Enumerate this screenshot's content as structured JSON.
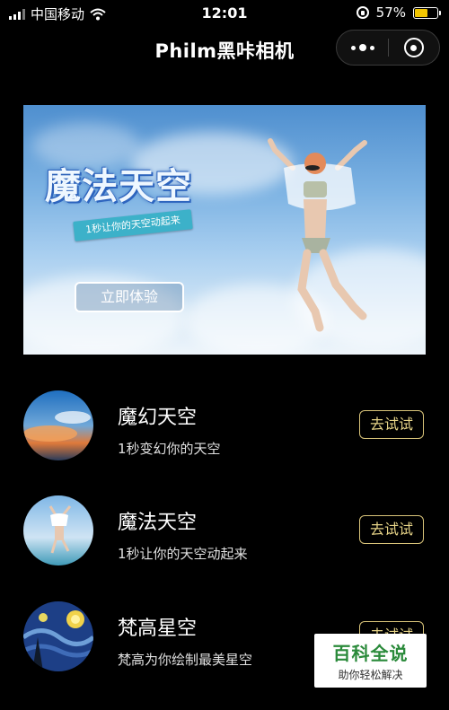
{
  "status_bar": {
    "carrier": "中国移动",
    "time": "12:01",
    "battery_percent": "57%",
    "battery_level": 0.57,
    "icons": [
      "signal-icon",
      "wifi-icon",
      "rotation-lock-icon",
      "battery-icon"
    ]
  },
  "nav": {
    "title": "Philm黑咔相机",
    "more_icon": "more-dots-icon",
    "close_icon": "close-circle-icon"
  },
  "banner": {
    "title": "魔法天空",
    "subtitle": "1秒让你的天空动起来",
    "button_label": "立即体验"
  },
  "list": [
    {
      "title": "魔幻天空",
      "subtitle": "1秒变幻你的天空",
      "button": "去试试"
    },
    {
      "title": "魔法天空",
      "subtitle": "1秒让你的天空动起来",
      "button": "去试试"
    },
    {
      "title": "梵高星空",
      "subtitle": "梵高为你绘制最美星空",
      "button": "去试试"
    }
  ],
  "watermark": {
    "main": "百科全说",
    "sub": "助你轻松解决"
  },
  "colors": {
    "accent_gold": "#e7d488",
    "battery": "#f2c500",
    "watermark_green": "#2a8a3a"
  }
}
